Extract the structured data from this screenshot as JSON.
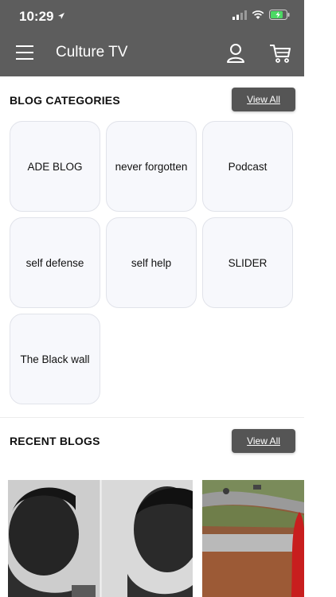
{
  "status": {
    "time": "10:29"
  },
  "app": {
    "title": "Culture TV"
  },
  "categories": {
    "title": "BLOG CATEGORIES",
    "view_all": "View All",
    "items": [
      {
        "label": "ADE BLOG"
      },
      {
        "label": "never forgotten"
      },
      {
        "label": "Podcast"
      },
      {
        "label": "self defense"
      },
      {
        "label": "self help"
      },
      {
        "label": "SLIDER"
      },
      {
        "label": "The Black wall"
      }
    ]
  },
  "recent": {
    "title": "RECENT BLOGS",
    "view_all": "View All"
  },
  "colors": {
    "header": "#5d5d5d",
    "button": "#555555",
    "card_bg": "#f7f8fc"
  }
}
